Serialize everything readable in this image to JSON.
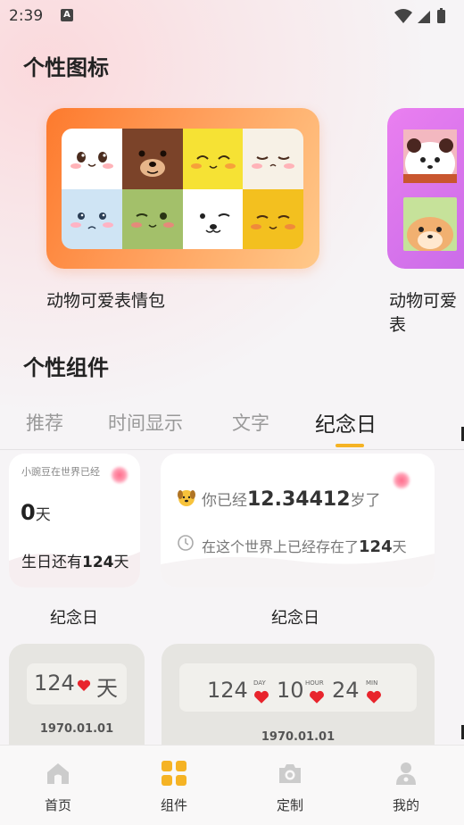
{
  "status_bar": {
    "time": "2:39",
    "notification": "A"
  },
  "icons_section": {
    "title": "个性图标",
    "packs": [
      {
        "caption": "动物可爱表情包"
      },
      {
        "caption": "动物可爱表"
      }
    ]
  },
  "widgets_section": {
    "title": "个性组件",
    "tabs": [
      {
        "label": "推荐"
      },
      {
        "label": "时间显示"
      },
      {
        "label": "文字"
      },
      {
        "label": "纪念日"
      }
    ],
    "active_tab": "纪念日",
    "cards": [
      {
        "header": "小豌豆在世界已经",
        "days_number": "0",
        "days_unit": "天",
        "birthday_prefix": "生日还有",
        "birthday_number": "124",
        "birthday_unit": "天",
        "caption": "纪念日"
      },
      {
        "age_prefix": "你已经",
        "age_value": "12.34412",
        "age_suffix": "岁了",
        "life_prefix": "在这个世界上已经存在了",
        "life_value": "124",
        "life_suffix": "天",
        "caption": "纪念日"
      },
      {
        "days": "124",
        "unit": "天",
        "date": "1970.01.01"
      },
      {
        "day_value": "124",
        "day_label": "DAY",
        "hour_value": "10",
        "hour_label": "HOUR",
        "min_value": "24",
        "min_label": "MIN",
        "date": "1970.01.01"
      }
    ]
  },
  "bottom_nav": {
    "items": [
      {
        "label": "首页",
        "icon": "home-icon"
      },
      {
        "label": "组件",
        "icon": "widgets-icon"
      },
      {
        "label": "定制",
        "icon": "camera-icon"
      },
      {
        "label": "我的",
        "icon": "profile-icon"
      }
    ],
    "active": "组件"
  },
  "colors": {
    "accent": "#f5b324",
    "heart": "#e8242c",
    "card_orange": "#fd7a2d",
    "card_purple": "#d678ec"
  }
}
